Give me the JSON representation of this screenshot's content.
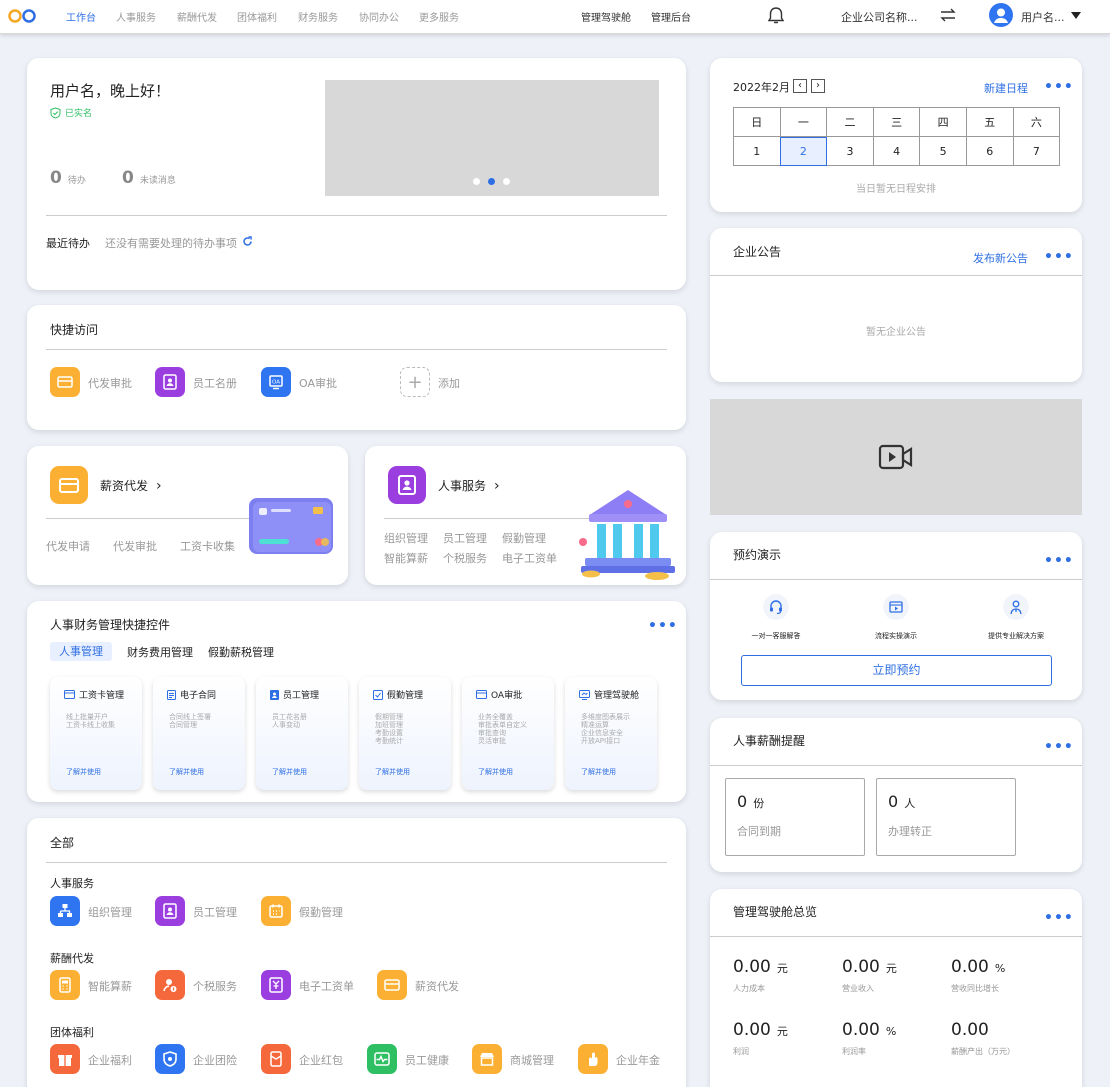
{
  "nav": {
    "tabs": [
      "工作台",
      "人事服务",
      "薪酬代发",
      "团体福利",
      "财务服务",
      "协同办公",
      "更多服务"
    ],
    "cockpit": "管理驾驶舱",
    "admin": "管理后台",
    "company": "企业公司名称...",
    "user": "用户名..."
  },
  "welcome": {
    "greeting": "用户名，晚上好！",
    "verified": "已实名",
    "pending_count": "0",
    "pending_label": "待办",
    "unread_count": "0",
    "unread_label": "未读消息",
    "recent_title": "最近待办",
    "recent_empty": "还没有需要处理的待办事项"
  },
  "quick": {
    "title": "快捷访问",
    "items": [
      "代发审批",
      "员工名册",
      "OA审批"
    ],
    "add": "添加"
  },
  "promo_payroll": {
    "title": "薪资代发",
    "links": [
      "代发申请",
      "代发审批",
      "工资卡收集"
    ]
  },
  "promo_hr": {
    "title": "人事服务",
    "links": [
      "组织管理",
      "员工管理",
      "假勤管理",
      "智能算薪",
      "个税服务",
      "电子工资单"
    ]
  },
  "widgets": {
    "title": "人事财务管理快捷控件",
    "tabs": [
      "人事管理",
      "财务费用管理",
      "假勤薪税管理"
    ],
    "cards": [
      {
        "title": "工资卡管理",
        "desc": "线上批量开户\n工资卡线上收集",
        "action": "了解并使用"
      },
      {
        "title": "电子合同",
        "desc": "合同线上签署\n合同管理",
        "action": "了解并使用"
      },
      {
        "title": "员工管理",
        "desc": "员工花名册\n人事变动",
        "action": "了解并使用"
      },
      {
        "title": "假勤管理",
        "desc": "假期管理\n加班管理\n考勤设置\n考勤统计",
        "action": "了解并使用"
      },
      {
        "title": "OA审批",
        "desc": "业务全覆盖\n审批表单自定义\n审批查询\n灵活审批",
        "action": "了解并使用"
      },
      {
        "title": "管理驾驶舱",
        "desc": "多维度图表展示\n精准运算\n企业信息安全\n开放API接口",
        "action": "了解并使用"
      }
    ]
  },
  "all": {
    "title": "全部",
    "groups": [
      {
        "name": "人事服务",
        "items": [
          "组织管理",
          "员工管理",
          "假勤管理"
        ]
      },
      {
        "name": "薪酬代发",
        "items": [
          "智能算薪",
          "个税服务",
          "电子工资单",
          "薪资代发"
        ]
      },
      {
        "name": "团体福利",
        "items": [
          "企业福利",
          "企业团险",
          "企业红包",
          "员工健康",
          "商城管理",
          "企业年金"
        ]
      }
    ]
  },
  "calendar": {
    "month": "2022年2月",
    "new": "新建日程",
    "weekdays": [
      "日",
      "一",
      "二",
      "三",
      "四",
      "五",
      "六"
    ],
    "days": [
      "1",
      "2",
      "3",
      "4",
      "5",
      "6",
      "7"
    ],
    "empty": "当日暂无日程安排"
  },
  "notice": {
    "title": "企业公告",
    "publish": "发布新公告",
    "empty": "暂无企业公告"
  },
  "demo": {
    "title": "预约演示",
    "items": [
      "一对一客服解答",
      "流程实操演示",
      "提供专业解决方案"
    ],
    "button": "立即预约"
  },
  "reminder": {
    "title": "人事薪酬提醒",
    "boxes": [
      {
        "value": "0",
        "unit": "份",
        "label": "合同到期"
      },
      {
        "value": "0",
        "unit": "人",
        "label": "办理转正"
      }
    ]
  },
  "overview": {
    "title": "管理驾驶舱总览",
    "stats": [
      {
        "value": "0.00",
        "unit": "元",
        "label": "人力成本"
      },
      {
        "value": "0.00",
        "unit": "元",
        "label": "营业收入"
      },
      {
        "value": "0.00",
        "unit": "%",
        "label": "营收同比增长"
      },
      {
        "value": "0.00",
        "unit": "元",
        "label": "利润"
      },
      {
        "value": "0.00",
        "unit": "%",
        "label": "利润率"
      },
      {
        "value": "0.00",
        "unit": "",
        "label": "薪酬产出（万元）"
      }
    ]
  }
}
